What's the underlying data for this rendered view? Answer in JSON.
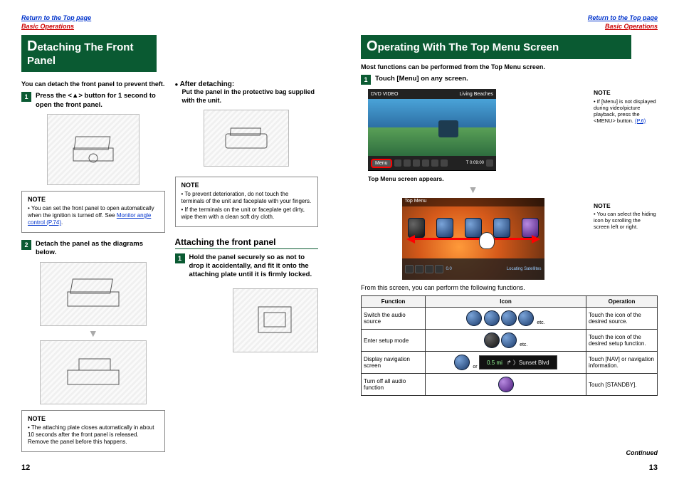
{
  "links": {
    "top": "Return to the Top page",
    "basic": "Basic Operations"
  },
  "left": {
    "title_pre": "D",
    "title_rest": "etaching The Front Panel",
    "intro": "You can detach the front panel to prevent theft.",
    "step1": "Press the <▲> button for 1 second to open the front panel.",
    "note1_title": "NOTE",
    "note1_items": [
      "You can set the front panel to open automatically when the ignition is turned off. See "
    ],
    "note1_link": "Monitor angle control (P.74)",
    "note1_post": ".",
    "step2": "Detach the panel as the diagrams below.",
    "note3_title": "NOTE",
    "note3_items": [
      "The attaching plate closes automatically in about 10 seconds after the front panel is released. Remove the panel before this happens."
    ],
    "after_detaching": "After detaching:",
    "after_text": "Put the panel in the protective bag supplied with the unit.",
    "note2_title": "NOTE",
    "note2_items": [
      "To prevent deterioration, do not touch the terminals of the unit and faceplate with your fingers.",
      "If the terminals on the unit or faceplate get dirty, wipe them with a clean soft dry cloth."
    ],
    "attach_title": "Attaching the front panel",
    "attach_step1": "Hold the panel securely so as not to drop it accidentally, and fit it onto the attaching plate until it is firmly locked."
  },
  "right": {
    "title_pre": "O",
    "title_rest": "perating With The Top Menu Screen",
    "intro": "Most functions can be performed from the Top Menu screen.",
    "step1": "Touch [Menu] on any screen.",
    "dvd_title1": "DVD VIDEO",
    "dvd_title2": "Living Beaches",
    "dvd_time": "T 0:09:00",
    "menu_btn": "Menu",
    "caption1": "Top Menu screen appears.",
    "tm_header": "Top Menu",
    "tm_loc": "Locating Satellites",
    "tm_nav": "0.0",
    "caption2": "From this screen, you can perform the following functions.",
    "side_note1_title": "NOTE",
    "side_note1_items": [
      "If [Menu] is not displayed during video/picture playback, press the <MENU> button. "
    ],
    "side_note1_link": "(P.6)",
    "side_note2_title": "NOTE",
    "side_note2_items": [
      "You can select the hiding icon by scrolling the screen left or right."
    ],
    "table": {
      "headers": [
        "Function",
        "Icon",
        "Operation"
      ],
      "rows": [
        {
          "fn": "Switch the audio source",
          "etc": "etc.",
          "op": "Touch the icon of the desired source."
        },
        {
          "fn": "Enter setup mode",
          "etc": "etc.",
          "op": "Touch the icon of the desired setup function."
        },
        {
          "fn": "Display navigation screen",
          "or": "or",
          "nav_dist": "0.5 mi",
          "nav_dest": "Sunset Blvd",
          "op": "Touch [NAV] or navigation information."
        },
        {
          "fn": "Turn off all audio function",
          "op": "Touch [STANDBY]."
        }
      ]
    },
    "continued": "Continued"
  },
  "page_left_num": "12",
  "page_right_num": "13"
}
